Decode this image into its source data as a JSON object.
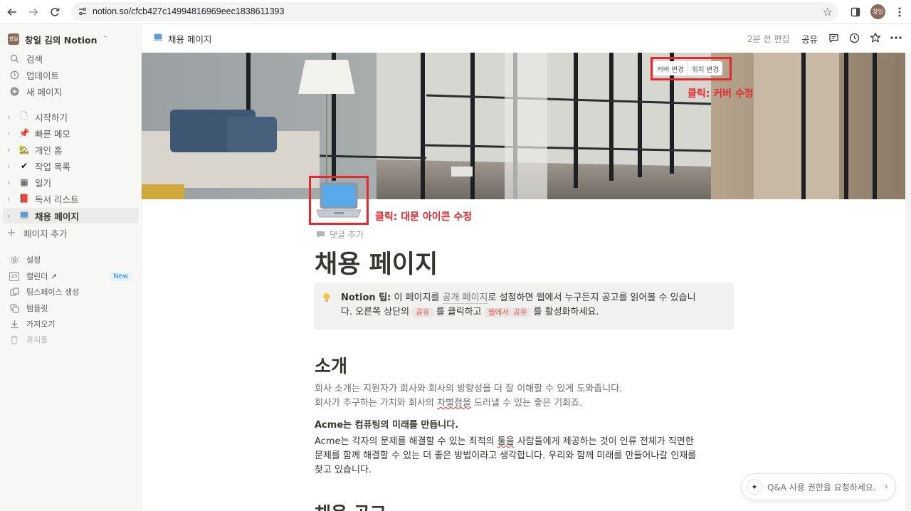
{
  "browser": {
    "url": "notion.so/cfcb427c14994816969eec1838611393",
    "profile_label": "창일"
  },
  "sidebar": {
    "workspace": {
      "avatar": "창일",
      "name": "창일 김의 Notion"
    },
    "nav": [
      {
        "label": "검색",
        "icon": "search-icon"
      },
      {
        "label": "업데이트",
        "icon": "clock-icon"
      },
      {
        "label": "새 페이지",
        "icon": "plus-circle-icon"
      }
    ],
    "pages": [
      {
        "label": "시작하기",
        "icon": "document-icon",
        "glyph": "🗋",
        "caret": "›",
        "active": false
      },
      {
        "label": "빠른 메모",
        "icon": "pushpin-icon",
        "glyph": "📌",
        "caret": "›",
        "active": false
      },
      {
        "label": "개인 홈",
        "icon": "house-icon",
        "glyph": "🏡",
        "caret": "›",
        "active": false
      },
      {
        "label": "작업 목록",
        "icon": "checkmark-icon",
        "glyph": "✔",
        "caret": "›",
        "active": false
      },
      {
        "label": "일기",
        "icon": "notebook-icon",
        "glyph": "▦",
        "caret": "›",
        "active": false
      },
      {
        "label": "독서 리스트",
        "icon": "red-book-icon",
        "glyph": "📕",
        "caret": "›",
        "active": false
      },
      {
        "label": "채용 페이지",
        "icon": "laptop-icon",
        "glyph": "💻",
        "caret": "›",
        "active": true
      }
    ],
    "add_page": "페이지 추가",
    "tools": [
      {
        "label": "설정",
        "icon": "gear-icon"
      },
      {
        "label": "캘린더 ↗",
        "icon": "calendar-icon",
        "calendar_day": "23",
        "badge": "New"
      },
      {
        "label": "팀스페이스 생성",
        "icon": "teamspace-icon"
      },
      {
        "label": "템플릿",
        "icon": "template-icon"
      },
      {
        "label": "가져오기",
        "icon": "download-icon"
      },
      {
        "label": "휴지통",
        "icon": "trash-icon"
      }
    ]
  },
  "topbar": {
    "breadcrumb": "채용 페이지",
    "edited": "2분 전 편집",
    "share": "공유"
  },
  "cover": {
    "change_cover": "커버 변경",
    "reposition": "위치 변경"
  },
  "annotations": {
    "cover": "클릭: 커버 수정",
    "icon": "클릭: 대문 아이콘 수정"
  },
  "page": {
    "add_comment": "댓글 추가",
    "title": "채용 페이지",
    "callout": {
      "label": "Notion 팁:",
      "t1": " 이 페이지를 ",
      "link": "공개 페이지",
      "t2": "로 설정하면 웹에서 누구든지 공고를 읽어볼 수 있습니",
      "t3": "다. 오른쪽 상단의 ",
      "code1": "공유",
      "t4": " 를 클릭하고 ",
      "code2": "웹에서 공유",
      "t5": " 를 활성화하세요."
    },
    "intro_heading": "소개",
    "intro_line1": "회사 소개는 지원자가 회사와 회사의 방향성을 더 잘 이해할 수 있게 도와줍니다.",
    "intro_line2_a": "회사가 추구하는 가치와 회사의 ",
    "intro_line2_b": "차별점을",
    "intro_line2_c": " 드러낼 수 있는 좋은 기회죠.",
    "bold_line": "Acme는 컴퓨팅의 미래를 만듭니다.",
    "body1_a": "Acme는 각자의 문제를 해결할 수 있는 최적의 ",
    "body1_b": "툴을",
    "body1_c": " 사람들에게 제공하는 것이 인류 전체가 직면한",
    "body2": "문제를 함께 해결할 수 있는 더 좋은 방법이라고 생각합니다. 우리와 함께 미래를 만들어나갈 인재를",
    "body3": "찾고 있습니다.",
    "next_heading": "채용 공고"
  },
  "qa": {
    "label": "Q&A 사용 권한을 요청하세요."
  }
}
